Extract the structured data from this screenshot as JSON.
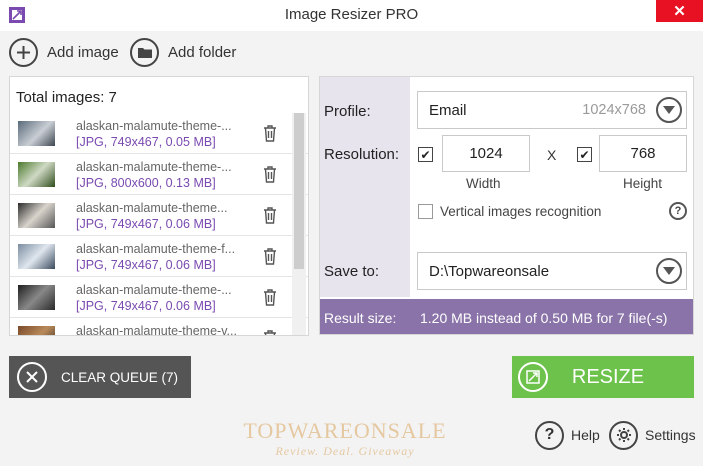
{
  "window": {
    "title": "Image Resizer PRO",
    "close_glyph": "✕"
  },
  "toolbar": {
    "add_image": "Add image",
    "add_folder": "Add folder"
  },
  "queue": {
    "total_label": "Total images: 7",
    "items": [
      {
        "name": "alaskan-malamute-theme-...",
        "info": "[JPG, 749x467, 0.05 MB]"
      },
      {
        "name": "alaskan-malamute-theme-...",
        "info": "[JPG, 800x600, 0.13 MB]"
      },
      {
        "name": "alaskan-malamute-theme...",
        "info": "[JPG, 749x467, 0.06 MB]"
      },
      {
        "name": "alaskan-malamute-theme-f...",
        "info": "[JPG, 749x467, 0.06 MB]"
      },
      {
        "name": "alaskan-malamute-theme-...",
        "info": "[JPG, 749x467, 0.06 MB]"
      },
      {
        "name": "alaskan-malamute-theme-v...",
        "info": ""
      }
    ]
  },
  "settings_panel": {
    "profile_label": "Profile:",
    "profile_value": "Email",
    "profile_size": "1024x768",
    "resolution_label": "Resolution:",
    "width_value": "1024",
    "height_value": "768",
    "x_separator": "X",
    "width_caption": "Width",
    "height_caption": "Height",
    "vertical_recognition": "Vertical images recognition",
    "help_glyph": "?",
    "save_to_label": "Save to:",
    "save_to_value": "D:\\Topwareonsale",
    "result_label": "Result size:",
    "result_value": "1.20 MB instead of 0.50 MB for 7 file(-s)"
  },
  "actions": {
    "clear_queue": "CLEAR QUEUE (7)",
    "resize": "RESIZE"
  },
  "footer": {
    "help": "Help",
    "settings": "Settings"
  },
  "watermark": {
    "main": "TOPWAREONSALE",
    "sub": "Review. Deal. Giveaway"
  },
  "colors": {
    "accent_purple": "#8a73a8",
    "resize_green": "#6cc24a",
    "clear_gray": "#555555",
    "close_red": "#e81123"
  }
}
